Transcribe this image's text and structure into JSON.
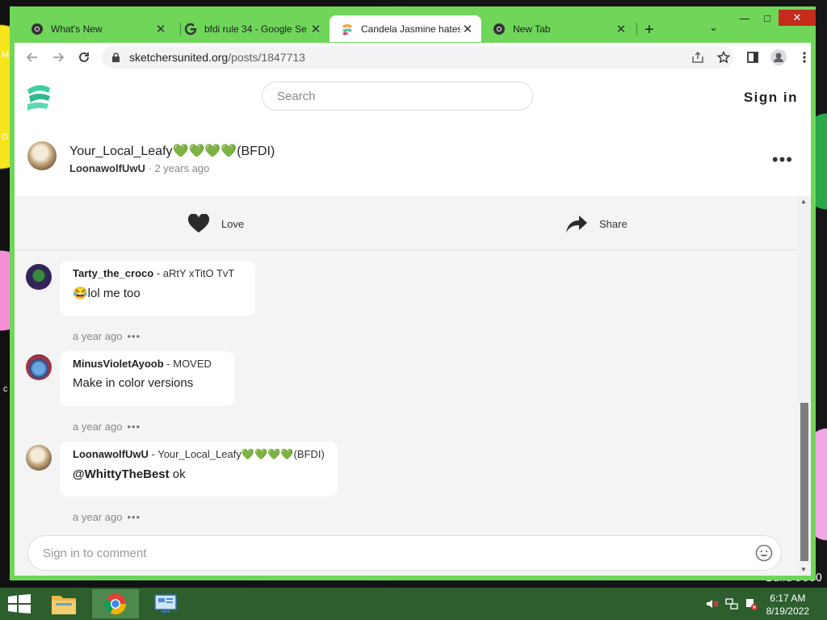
{
  "desktop": {
    "build_text": "Build 9600",
    "label_m": "M",
    "label_d": "D",
    "label_c": "c"
  },
  "browser": {
    "tabs": [
      {
        "title": "What's New",
        "icon": "chrome-icon"
      },
      {
        "title": "bfdi rule 34 - Google Se",
        "icon": "google-icon"
      },
      {
        "title": "Candela Jasmine hates",
        "icon": "sketchers-icon",
        "active": true
      },
      {
        "title": "New Tab",
        "icon": "chrome-icon"
      }
    ],
    "new_tab_symbol": "+",
    "tab_list_symbol": "⌄",
    "controls": {
      "minimize": "—",
      "maximize": "□",
      "close": "✕"
    },
    "url_host": "sketchersunited.org",
    "url_path": "/posts/1847713"
  },
  "site": {
    "search_placeholder": "Search",
    "sign_in": "Sign in",
    "post": {
      "title": "Your_Local_Leafy💚💚💚💚(BFDI)",
      "author": "LoonawolfUwU",
      "time": "2 years ago",
      "more": "•••"
    },
    "actions": {
      "love": "Love",
      "share": "Share"
    },
    "comments": [
      {
        "user": "Tarty_the_croco",
        "subtitle": "aRtY xTitO TvT",
        "text": "😂lol me too",
        "time": "a year ago"
      },
      {
        "user": "MinusVioletAyoob",
        "subtitle": "MOVED",
        "text": "Make in color versions",
        "time": "a year ago"
      },
      {
        "user": "LoonawolfUwU",
        "subtitle": "Your_Local_Leafy💚💚💚💚(BFDI)",
        "mention": "@WhittyTheBest",
        "text": " ok",
        "time": "a year ago"
      }
    ],
    "comment_dots": "•••",
    "comment_placeholder": "Sign in to comment"
  },
  "taskbar": {
    "time": "6:17 AM",
    "date": "8/19/2022"
  },
  "colors": {
    "window_frame": "#6fd65a",
    "taskbar": "#2d5f2e",
    "close": "#c42b1c"
  }
}
